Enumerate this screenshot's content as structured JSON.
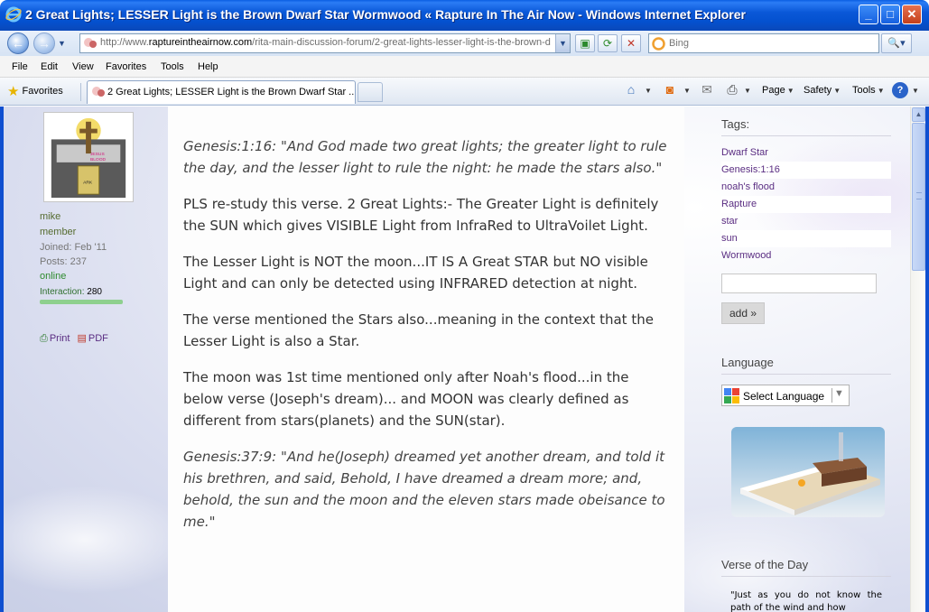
{
  "window": {
    "title": "2 Great Lights; LESSER Light is the Brown Dwarf Star Wormwood « Rapture In The Air Now - Windows Internet Explorer",
    "minimize": "_",
    "maximize": "□",
    "close": "✕"
  },
  "address": {
    "url_prefix": "http://www.",
    "url_domain": "raptureintheair now.com",
    "url_domain_clean": "raptureintheairnow.com",
    "url_rest": "/rita-main-discussion-forum/2-great-lights-lesser-light-is-the-brown-d"
  },
  "search": {
    "placeholder": "Bing",
    "button": "🔍▾"
  },
  "menu": [
    "File",
    "Edit",
    "View",
    "Favorites",
    "Tools",
    "Help"
  ],
  "toolbar": {
    "favorites": "Favorites",
    "tab_title": "2 Great Lights; LESSER Light is the Brown Dwarf Star ...",
    "page": "Page",
    "safety": "Safety",
    "tools": "Tools"
  },
  "author": {
    "name": "mike",
    "role": "member",
    "joined": "Joined: Feb '11",
    "posts": "Posts: 237",
    "status": "online",
    "interaction_label": "Interaction:",
    "interaction_value": "280",
    "print": "Print",
    "pdf": "PDF"
  },
  "post": {
    "paragraphs": [
      {
        "verse": true,
        "text": "Genesis:1:16: \"And God made two great lights; the greater light to rule the day, and the lesser light to rule the night: he made the stars also.\""
      },
      {
        "verse": false,
        "text": "PLS re-study this verse. 2 Great Lights:- The Greater Light is definitely the SUN which gives VISIBLE Light from InfraRed to UltraVoilet Light."
      },
      {
        "verse": false,
        "text": "The Lesser Light is NOT the moon...IT IS A Great STAR but NO visible Light and can only be detected using INFRARED detection at night."
      },
      {
        "verse": false,
        "text": "The verse mentioned the Stars also...meaning in the context that the Lesser Light is also a Star."
      },
      {
        "verse": false,
        "text": "The moon was 1st time mentioned only after Noah's flood...in the below verse (Joseph's dream)... and MOON was clearly defined as different from stars(planets) and the SUN(star)."
      },
      {
        "verse": true,
        "text": "Genesis:37:9: \"And he(Joseph) dreamed yet another dream, and told it his brethren, and said, Behold, I have dreamed a dream more; and, behold, the sun and the moon and the eleven stars made obeisance to me.\""
      }
    ]
  },
  "sidebar": {
    "tags_heading": "Tags:",
    "tags": [
      "Dwarf Star",
      "Genesis:1:16",
      "noah's flood",
      "Rapture",
      "star",
      "sun",
      "Wormwood"
    ],
    "add_button": "add »",
    "language_heading": "Language",
    "language_select": "Select Language",
    "verse_heading": "Verse of the Day",
    "verse_text": "\"Just as you do not know the path of the wind and how"
  }
}
